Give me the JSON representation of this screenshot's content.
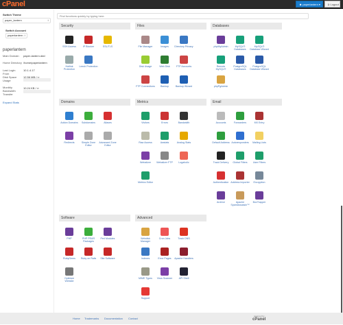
{
  "header": {
    "logo": "cPanel",
    "user": "paperlantern",
    "logout": "Logout"
  },
  "sidebar": {
    "switch_theme_label": "Switch Theme",
    "theme": "paper_lantern",
    "switch_account_label": "Switch Account",
    "account": "paperlantern",
    "account_heading": "paperlantern",
    "stats": [
      {
        "label": "Main Domain",
        "value": "paper-lantern.ddd"
      },
      {
        "label": "Home Directory",
        "value": "/home/paperlantern"
      },
      {
        "label": "Last Login From",
        "value": "10.1.4.17"
      },
      {
        "label": "Disk Space Usage",
        "value": "12.56 MB / ∞"
      },
      {
        "label": "Monthly Bandwidth Transfer",
        "value": "10.24 KB / ∞"
      }
    ],
    "expand": "Expand Stats"
  },
  "search": {
    "placeholder": "Find functions quickly by typing here."
  },
  "sections": [
    {
      "title": "Security",
      "items": [
        {
          "label": "SSH Access",
          "color": "#222"
        },
        {
          "label": "IP Blocker",
          "color": "#c62828"
        },
        {
          "label": "SSL/TLS",
          "color": "#e6b800"
        },
        {
          "label": "Hotlink Protection",
          "color": "#9aa"
        },
        {
          "label": "Leech Protection",
          "color": "#3a78c3"
        }
      ]
    },
    {
      "title": "Files",
      "items": [
        {
          "label": "File Manager",
          "color": "#a88"
        },
        {
          "label": "Images",
          "color": "#3b8fd6"
        },
        {
          "label": "Directory Privacy",
          "color": "#3a78c3"
        },
        {
          "label": "Disk Usage",
          "color": "#9c3"
        },
        {
          "label": "Web Disk",
          "color": "#2e7d32"
        },
        {
          "label": "FTP Accounts",
          "color": "#c44"
        },
        {
          "label": "FTP Connections",
          "color": "#c44"
        },
        {
          "label": "Backup",
          "color": "#1e5fb3"
        },
        {
          "label": "Backup Wizard",
          "color": "#1e5fb3"
        }
      ]
    },
    {
      "title": "Databases",
      "items": [
        {
          "label": "phpMyAdmin",
          "color": "#6a3d9a"
        },
        {
          "label": "MySQL® Databases",
          "color": "#17a07a"
        },
        {
          "label": "MySQL® Database Wizard",
          "color": "#17a07a"
        },
        {
          "label": "Remote MySQL®",
          "color": "#17a07a"
        },
        {
          "label": "PostgreSQL Databases",
          "color": "#2a5aa8"
        },
        {
          "label": "PostgreSQL Database Wizard",
          "color": "#2a5aa8"
        },
        {
          "label": "phpPgAdmin",
          "color": "#d9a441"
        }
      ]
    },
    {
      "title": "Domains",
      "items": [
        {
          "label": "Addon Domains",
          "color": "#2f7fd0"
        },
        {
          "label": "Subdomains",
          "color": "#3cae3c"
        },
        {
          "label": "Aliases",
          "color": "#d63031"
        },
        {
          "label": "Redirects",
          "color": "#7b3fa6"
        },
        {
          "label": "Simple Zone Editor",
          "color": "#aaa"
        },
        {
          "label": "Advanced Zone Editor",
          "color": "#aaa"
        }
      ]
    },
    {
      "title": "Metrics",
      "items": [
        {
          "label": "Visitors",
          "color": "#1e9e6a"
        },
        {
          "label": "Errors",
          "color": "#c33"
        },
        {
          "label": "Bandwidth",
          "color": "#333"
        },
        {
          "label": "Raw Access",
          "color": "#bba"
        },
        {
          "label": "Awstats",
          "color": "#1e9e6a"
        },
        {
          "label": "Analog Stats",
          "color": "#e6a800"
        },
        {
          "label": "Webalizer",
          "color": "#7b3fa6"
        },
        {
          "label": "Webalizer FTP",
          "color": "#888"
        },
        {
          "label": "Logaholic",
          "color": "#e65"
        },
        {
          "label": "Metrics Editor",
          "color": "#1e9e6a"
        }
      ]
    },
    {
      "title": "Email",
      "items": [
        {
          "label": "Accounts",
          "color": "#bbb"
        },
        {
          "label": "Forwarders",
          "color": "#2e9e3e"
        },
        {
          "label": "MX Entry",
          "color": "#a33"
        },
        {
          "label": "Default Address",
          "color": "#2e9e3e"
        },
        {
          "label": "Autoresponders",
          "color": "#2f6fd0"
        },
        {
          "label": "Mailing Lists",
          "color": "#f2d061"
        },
        {
          "label": "Track Delivery",
          "color": "#222"
        },
        {
          "label": "Global Filters",
          "color": "#1e9e6a"
        },
        {
          "label": "User Filters",
          "color": "#1e9e6a"
        },
        {
          "label": "Authentication",
          "color": "#d63031"
        },
        {
          "label": "Address Importer",
          "color": "#a33"
        },
        {
          "label": "Encryption",
          "color": "#789"
        },
        {
          "label": "Archive",
          "color": "#6a3d9a"
        },
        {
          "label": "Apache SpamAssassin™",
          "color": "#c89a5a"
        },
        {
          "label": "BoxTrapper",
          "color": "#6a3d9a"
        }
      ]
    },
    {
      "title": "Software",
      "items": [
        {
          "label": "PHP",
          "color": "#6a3d9a"
        },
        {
          "label": "PHP PEAR Packages",
          "color": "#3cae3c"
        },
        {
          "label": "Perl Modules",
          "color": "#6a3d9a"
        },
        {
          "label": "RubyGems",
          "color": "#c62828"
        },
        {
          "label": "Ruby on Rails",
          "color": "#c62828"
        },
        {
          "label": "Site Software",
          "color": "#c62828"
        },
        {
          "label": "Optimize Website",
          "color": "#777"
        }
      ]
    },
    {
      "title": "Advanced",
      "items": [
        {
          "label": "Webdisk Manager",
          "color": "#d9a441"
        },
        {
          "label": "Cron Jobs",
          "color": "#e55"
        },
        {
          "label": "Track DNS",
          "color": "#d32"
        },
        {
          "label": "Indexes",
          "color": "#3a78c3"
        },
        {
          "label": "Error Pages",
          "color": "#a22"
        },
        {
          "label": "Apache Handlers",
          "color": "#8b1e2e"
        },
        {
          "label": "MIME Types",
          "color": "#998"
        },
        {
          "label": "Virus Scanner",
          "color": "#7b3fa6"
        },
        {
          "label": "API Shell",
          "color": "#223"
        },
        {
          "label": "Support",
          "color": "#e53935"
        }
      ]
    }
  ],
  "footer": {
    "links": [
      "Home",
      "Trademarks",
      "Documentation",
      "Contact"
    ],
    "powered": "powered by",
    "logo": "cPanel"
  }
}
